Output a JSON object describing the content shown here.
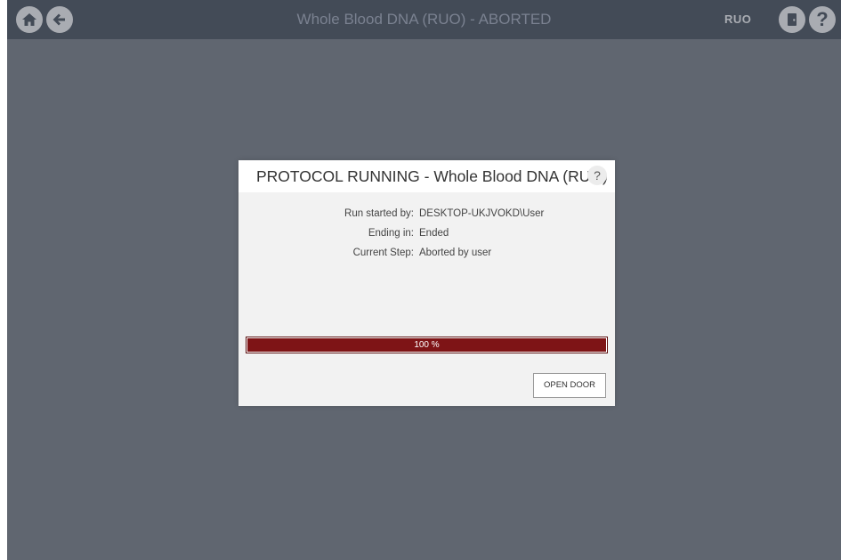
{
  "header": {
    "title": "Whole Blood DNA (RUO) - ABORTED",
    "mode_badge": "RUO",
    "icons": [
      "home-icon",
      "back-arrow-icon",
      "door-icon",
      "help-icon"
    ],
    "help_glyph": "?"
  },
  "dialog": {
    "title": "PROTOCOL RUNNING - Whole Blood DNA (RUO)",
    "help_glyph": "?",
    "info": [
      {
        "label": "Run started by:",
        "value": "DESKTOP-UKJVOKD\\User"
      },
      {
        "label": "Ending in:",
        "value": "Ended"
      },
      {
        "label": "Current Step:",
        "value": "Aborted by user"
      }
    ],
    "progress": {
      "percent": 100,
      "label": "100 %"
    },
    "open_door_label": "OPEN DOOR"
  },
  "colors": {
    "background": "#606670",
    "topbar": "#434b57",
    "progress_fill": "#7e1416",
    "dialog": "#f2f2f2"
  }
}
